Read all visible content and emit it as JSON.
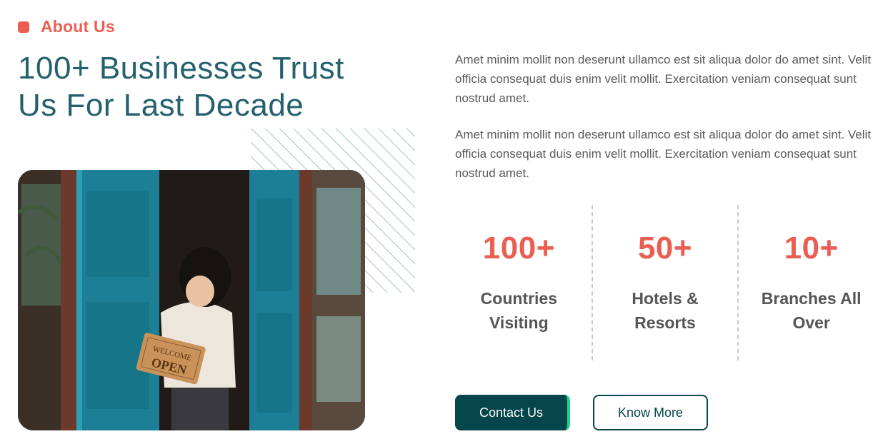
{
  "section": {
    "eyebrow": "About Us",
    "headline_line1": "100+ Businesses Trust",
    "headline_line2": "Us For Last Decade"
  },
  "image": {
    "alt": "Child holding a WELCOME WE'RE OPEN sign at blue doors",
    "sign_top": "WELCOME",
    "sign_bottom": "OPEN"
  },
  "paragraphs": [
    "Amet minim mollit non deserunt ullamco est sit aliqua dolor do amet sint. Velit officia consequat duis enim velit mollit. Exercitation veniam consequat sunt nostrud amet.",
    "Amet minim mollit non deserunt ullamco est sit aliqua dolor do amet sint. Velit officia consequat duis enim velit mollit. Exercitation veniam consequat sunt nostrud amet."
  ],
  "stats": [
    {
      "value": "100+",
      "label": "Countries Visiting"
    },
    {
      "value": "50+",
      "label": "Hotels & Resorts"
    },
    {
      "value": "10+",
      "label": "Branches All Over"
    }
  ],
  "buttons": {
    "primary": "Contact Us",
    "secondary": "Know More"
  },
  "colors": {
    "accent": "#eb5f52",
    "heading": "#24606d",
    "primary_button": "#05454c",
    "button_edge": "#1fd486",
    "stripes": "#a9c2c0"
  }
}
